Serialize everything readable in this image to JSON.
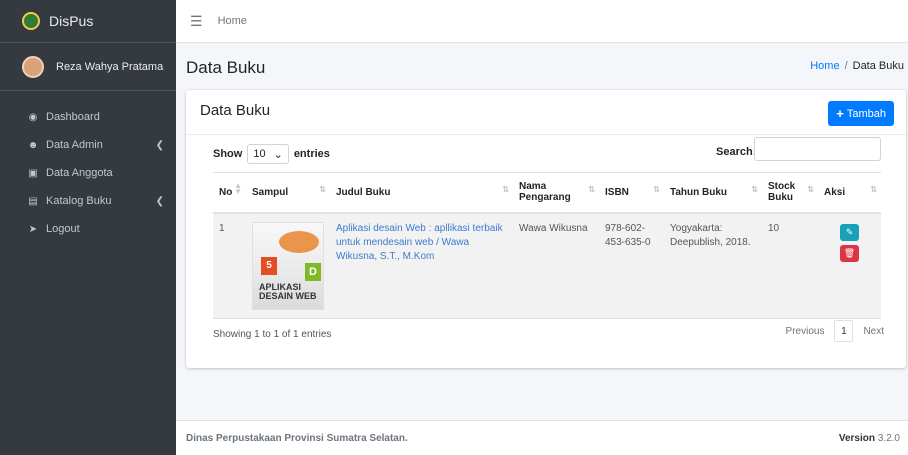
{
  "app": {
    "brand": "DisPus"
  },
  "user": {
    "name": "Reza Wahya Pratama"
  },
  "sidebar": {
    "items": [
      {
        "label": "Dashboard",
        "icon": "dashboard-icon",
        "has_chevron": false
      },
      {
        "label": "Data Admin",
        "icon": "users-cog-icon",
        "has_chevron": true
      },
      {
        "label": "Data Anggota",
        "icon": "id-card-icon",
        "has_chevron": false
      },
      {
        "label": "Katalog Buku",
        "icon": "book-open-icon",
        "has_chevron": true
      },
      {
        "label": "Logout",
        "icon": "sign-out-icon",
        "has_chevron": false
      }
    ]
  },
  "topbar": {
    "home": "Home"
  },
  "page": {
    "title": "Data Buku",
    "breadcrumb_home": "Home",
    "breadcrumb_sep": "/",
    "breadcrumb_current": "Data Buku"
  },
  "card": {
    "title": "Data Buku",
    "add_label": "Tambah",
    "show_label": "Show",
    "entries_value": "10",
    "entries_label": "entries",
    "search_label": "Search:",
    "search_value": ""
  },
  "table": {
    "headers": [
      "No",
      "Sampul",
      "Judul Buku",
      "Nama Pengarang",
      "ISBN",
      "Tahun Buku",
      "Stock Buku",
      "Aksi"
    ],
    "rows": [
      {
        "no": "1",
        "cover_text": "APLIKASI DESAIN WEB",
        "judul": "Aplikasi desain Web : apllikasi terbaik untuk mendesain web / Wawa Wikusna, S.T., M.Kom",
        "pengarang": "Wawa Wikusna",
        "isbn": "978-602-453-635-0",
        "tahun": "Yogyakarta: Deepublish, 2018.",
        "stock": "10"
      }
    ]
  },
  "pagination": {
    "info": "Showing 1 to 1 of 1 entries",
    "previous": "Previous",
    "current": "1",
    "next": "Next"
  },
  "footer": {
    "text": "Dinas Perpustakaan Provinsi Sumatra Selatan.",
    "version_label": "Version",
    "version_value": "3.2.0"
  },
  "colors": {
    "sidebar": "#343a40",
    "primary": "#007bff",
    "info": "#17a2b8",
    "danger": "#dc3545"
  }
}
